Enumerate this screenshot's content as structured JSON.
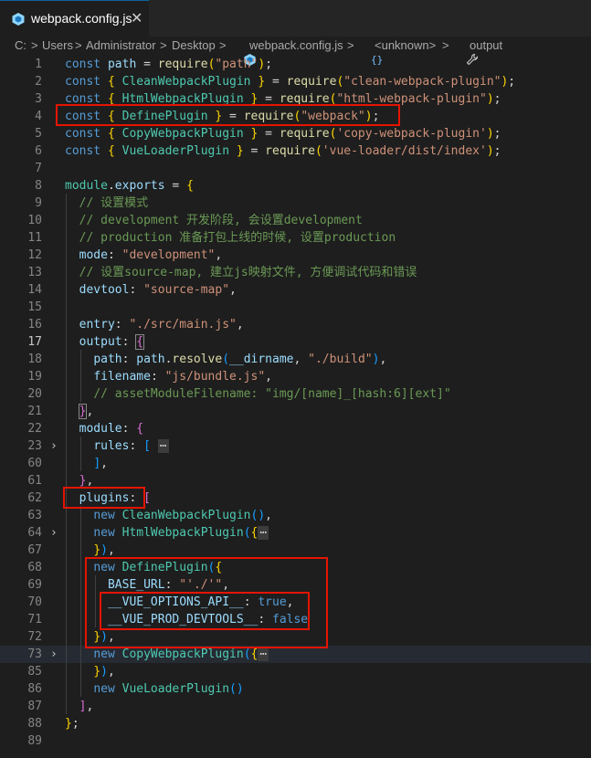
{
  "tab": {
    "title": "webpack.config.js",
    "close_glyph": "✕",
    "icon": "webpack-icon"
  },
  "breadcrumb": {
    "parts": [
      "C:",
      "Users",
      "Administrator",
      "Desktop",
      "webpack.config.js",
      "<unknown>",
      "output"
    ],
    "separator": ">",
    "icons": [
      "webpack-icon",
      "object-icon",
      "wrench-icon"
    ]
  },
  "editor": {
    "lines": [
      {
        "n": "1",
        "tokens": [
          [
            "kw",
            "const "
          ],
          [
            "id",
            "path"
          ],
          [
            "p",
            " = "
          ],
          [
            "fn",
            "require"
          ],
          [
            "b1",
            "("
          ],
          [
            "str",
            "\"path\""
          ],
          [
            "b1",
            ")"
          ],
          [
            "p",
            ";"
          ]
        ]
      },
      {
        "n": "2",
        "tokens": [
          [
            "kw",
            "const "
          ],
          [
            "b1",
            "{ "
          ],
          [
            "cls",
            "CleanWebpackPlugin"
          ],
          [
            "b1",
            " }"
          ],
          [
            "p",
            " = "
          ],
          [
            "fn",
            "require"
          ],
          [
            "b1",
            "("
          ],
          [
            "str",
            "\"clean-webpack-plugin\""
          ],
          [
            "b1",
            ")"
          ],
          [
            "p",
            ";"
          ]
        ]
      },
      {
        "n": "3",
        "tokens": [
          [
            "kw",
            "const "
          ],
          [
            "b1",
            "{ "
          ],
          [
            "cls",
            "HtmlWebpackPlugin"
          ],
          [
            "b1",
            " }"
          ],
          [
            "p",
            " = "
          ],
          [
            "fn",
            "require"
          ],
          [
            "b1",
            "("
          ],
          [
            "str",
            "\"html-webpack-plugin\""
          ],
          [
            "b1",
            ")"
          ],
          [
            "p",
            ";"
          ]
        ]
      },
      {
        "n": "4",
        "tokens": [
          [
            "kw",
            "const "
          ],
          [
            "b1",
            "{ "
          ],
          [
            "cls",
            "DefinePlugin"
          ],
          [
            "b1",
            " }"
          ],
          [
            "p",
            " = "
          ],
          [
            "fn",
            "require"
          ],
          [
            "b1",
            "("
          ],
          [
            "str",
            "\"webpack\""
          ],
          [
            "b1",
            ")"
          ],
          [
            "p",
            ";"
          ]
        ]
      },
      {
        "n": "5",
        "tokens": [
          [
            "kw",
            "const "
          ],
          [
            "b1",
            "{ "
          ],
          [
            "cls",
            "CopyWebpackPlugin"
          ],
          [
            "b1",
            " }"
          ],
          [
            "p",
            " = "
          ],
          [
            "fn",
            "require"
          ],
          [
            "b1",
            "("
          ],
          [
            "str",
            "'copy-webpack-plugin'"
          ],
          [
            "b1",
            ")"
          ],
          [
            "p",
            ";"
          ]
        ]
      },
      {
        "n": "6",
        "tokens": [
          [
            "kw",
            "const "
          ],
          [
            "b1",
            "{ "
          ],
          [
            "cls",
            "VueLoaderPlugin"
          ],
          [
            "b1",
            " }"
          ],
          [
            "p",
            " = "
          ],
          [
            "fn",
            "require"
          ],
          [
            "b1",
            "("
          ],
          [
            "str",
            "'vue-loader/dist/index'"
          ],
          [
            "b1",
            ")"
          ],
          [
            "p",
            ";"
          ]
        ]
      },
      {
        "n": "7",
        "tokens": []
      },
      {
        "n": "8",
        "tokens": [
          [
            "cls",
            "module"
          ],
          [
            "p",
            "."
          ],
          [
            "id",
            "exports"
          ],
          [
            "p",
            " = "
          ],
          [
            "b1",
            "{"
          ]
        ]
      },
      {
        "n": "9",
        "tokens": [
          [
            "p",
            "  "
          ],
          [
            "com",
            "// 设置模式"
          ]
        ]
      },
      {
        "n": "10",
        "tokens": [
          [
            "p",
            "  "
          ],
          [
            "com",
            "// development 开发阶段, 会设置development"
          ]
        ]
      },
      {
        "n": "11",
        "tokens": [
          [
            "p",
            "  "
          ],
          [
            "com",
            "// production 准备打包上线的时候, 设置production"
          ]
        ]
      },
      {
        "n": "12",
        "tokens": [
          [
            "p",
            "  "
          ],
          [
            "id",
            "mode"
          ],
          [
            "p",
            ": "
          ],
          [
            "str",
            "\"development\""
          ],
          [
            "p",
            ","
          ]
        ]
      },
      {
        "n": "13",
        "tokens": [
          [
            "p",
            "  "
          ],
          [
            "com",
            "// 设置source-map, 建立js映射文件, 方便调试代码和错误"
          ]
        ]
      },
      {
        "n": "14",
        "tokens": [
          [
            "p",
            "  "
          ],
          [
            "id",
            "devtool"
          ],
          [
            "p",
            ": "
          ],
          [
            "str",
            "\"source-map\""
          ],
          [
            "p",
            ","
          ]
        ]
      },
      {
        "n": "15",
        "tokens": []
      },
      {
        "n": "16",
        "tokens": [
          [
            "p",
            "  "
          ],
          [
            "id",
            "entry"
          ],
          [
            "p",
            ": "
          ],
          [
            "str",
            "\"./src/main.js\""
          ],
          [
            "p",
            ","
          ]
        ]
      },
      {
        "n": "17",
        "tokens": [
          [
            "p",
            "  "
          ],
          [
            "id",
            "output"
          ],
          [
            "p",
            ": "
          ],
          [
            "b2",
            "{"
          ]
        ]
      },
      {
        "n": "18",
        "tokens": [
          [
            "p",
            "    "
          ],
          [
            "id",
            "path"
          ],
          [
            "p",
            ": "
          ],
          [
            "id",
            "path"
          ],
          [
            "p",
            "."
          ],
          [
            "fn",
            "resolve"
          ],
          [
            "b3",
            "("
          ],
          [
            "id",
            "__dirname"
          ],
          [
            "p",
            ", "
          ],
          [
            "str",
            "\"./build\""
          ],
          [
            "b3",
            ")"
          ],
          [
            "p",
            ","
          ]
        ]
      },
      {
        "n": "19",
        "tokens": [
          [
            "p",
            "    "
          ],
          [
            "id",
            "filename"
          ],
          [
            "p",
            ": "
          ],
          [
            "str",
            "\"js/bundle.js\""
          ],
          [
            "p",
            ","
          ]
        ]
      },
      {
        "n": "20",
        "tokens": [
          [
            "p",
            "    "
          ],
          [
            "com",
            "// assetModuleFilename: \"img/[name]_[hash:6][ext]\""
          ]
        ]
      },
      {
        "n": "21",
        "tokens": [
          [
            "p",
            "  "
          ],
          [
            "b2",
            "}"
          ],
          [
            "p",
            ","
          ]
        ]
      },
      {
        "n": "22",
        "tokens": [
          [
            "p",
            "  "
          ],
          [
            "id",
            "module"
          ],
          [
            "p",
            ": "
          ],
          [
            "b2",
            "{"
          ]
        ]
      },
      {
        "n": "23",
        "fold": "›",
        "tokens": [
          [
            "p",
            "    "
          ],
          [
            "id",
            "rules"
          ],
          [
            "p",
            ": "
          ],
          [
            "b3",
            "["
          ],
          [
            "p",
            " "
          ],
          [
            "fold",
            "⋯"
          ]
        ]
      },
      {
        "n": "60",
        "tokens": [
          [
            "p",
            "    "
          ],
          [
            "b3",
            "]"
          ],
          [
            "p",
            ","
          ]
        ]
      },
      {
        "n": "61",
        "tokens": [
          [
            "p",
            "  "
          ],
          [
            "b2",
            "}"
          ],
          [
            "p",
            ","
          ]
        ]
      },
      {
        "n": "62",
        "tokens": [
          [
            "p",
            "  "
          ],
          [
            "id",
            "plugins"
          ],
          [
            "p",
            ": "
          ],
          [
            "b2",
            "["
          ]
        ]
      },
      {
        "n": "63",
        "tokens": [
          [
            "p",
            "    "
          ],
          [
            "kw",
            "new "
          ],
          [
            "cls",
            "CleanWebpackPlugin"
          ],
          [
            "b3",
            "()"
          ],
          [
            "p",
            ","
          ]
        ]
      },
      {
        "n": "64",
        "fold": "›",
        "tokens": [
          [
            "p",
            "    "
          ],
          [
            "kw",
            "new "
          ],
          [
            "cls",
            "HtmlWebpackPlugin"
          ],
          [
            "b3",
            "("
          ],
          [
            "b1",
            "{"
          ],
          [
            "fold",
            "⋯"
          ]
        ]
      },
      {
        "n": "67",
        "tokens": [
          [
            "p",
            "    "
          ],
          [
            "b1",
            "}"
          ],
          [
            "b3",
            ")"
          ],
          [
            "p",
            ","
          ]
        ]
      },
      {
        "n": "68",
        "tokens": [
          [
            "p",
            "    "
          ],
          [
            "kw",
            "new "
          ],
          [
            "cls",
            "DefinePlugin"
          ],
          [
            "b3",
            "("
          ],
          [
            "b1",
            "{"
          ]
        ]
      },
      {
        "n": "69",
        "tokens": [
          [
            "p",
            "      "
          ],
          [
            "id",
            "BASE_URL"
          ],
          [
            "p",
            ": "
          ],
          [
            "str",
            "\"'./'\""
          ],
          [
            "p",
            ","
          ]
        ]
      },
      {
        "n": "70",
        "tokens": [
          [
            "p",
            "      "
          ],
          [
            "id",
            "__VUE_OPTIONS_API__"
          ],
          [
            "p",
            ": "
          ],
          [
            "kw",
            "true"
          ],
          [
            "p",
            ","
          ]
        ]
      },
      {
        "n": "71",
        "tokens": [
          [
            "p",
            "      "
          ],
          [
            "id",
            "__VUE_PROD_DEVTOOLS__"
          ],
          [
            "p",
            ": "
          ],
          [
            "kw",
            "false"
          ]
        ]
      },
      {
        "n": "72",
        "tokens": [
          [
            "p",
            "    "
          ],
          [
            "b1",
            "}"
          ],
          [
            "b3",
            ")"
          ],
          [
            "p",
            ","
          ]
        ]
      },
      {
        "n": "73",
        "fold": "›",
        "tokens": [
          [
            "p",
            "    "
          ],
          [
            "kw",
            "new "
          ],
          [
            "cls",
            "CopyWebpackPlugin"
          ],
          [
            "b3",
            "("
          ],
          [
            "b1",
            "{"
          ],
          [
            "fold",
            "⋯"
          ]
        ]
      },
      {
        "n": "85",
        "tokens": [
          [
            "p",
            "    "
          ],
          [
            "b1",
            "}"
          ],
          [
            "b3",
            ")"
          ],
          [
            "p",
            ","
          ]
        ]
      },
      {
        "n": "86",
        "tokens": [
          [
            "p",
            "    "
          ],
          [
            "kw",
            "new "
          ],
          [
            "cls",
            "VueLoaderPlugin"
          ],
          [
            "b3",
            "()"
          ]
        ]
      },
      {
        "n": "87",
        "tokens": [
          [
            "p",
            "  "
          ],
          [
            "b2",
            "]"
          ],
          [
            "p",
            ","
          ]
        ]
      },
      {
        "n": "88",
        "tokens": [
          [
            "b1",
            "}"
          ],
          [
            "p",
            ";"
          ]
        ]
      },
      {
        "n": "89",
        "tokens": []
      }
    ],
    "active_line": "17"
  }
}
